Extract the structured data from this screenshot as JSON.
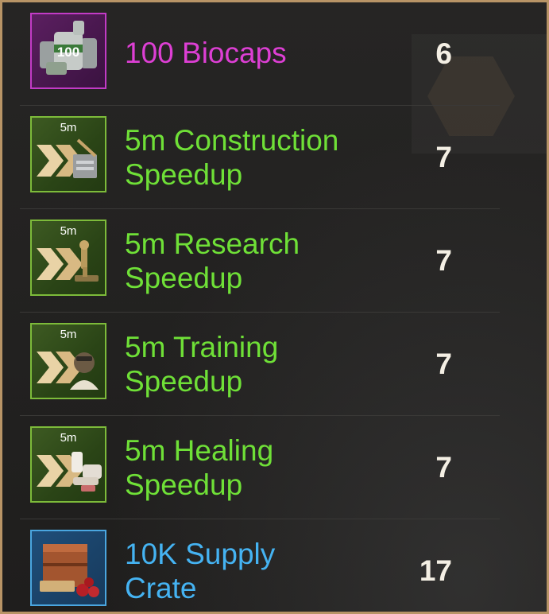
{
  "items": [
    {
      "name_line1": "100 Biocaps",
      "name_line2": "",
      "quantity": "6",
      "badge": "100",
      "rarity_color": "#dd3fd4",
      "icon": "biocaps-icon"
    },
    {
      "name_line1": "5m Construction",
      "name_line2": "Speedup",
      "quantity": "7",
      "badge": "5m",
      "rarity_color": "#6fe037",
      "icon": "construction-speedup-icon"
    },
    {
      "name_line1": "5m Research",
      "name_line2": "Speedup",
      "quantity": "7",
      "badge": "5m",
      "rarity_color": "#6fe037",
      "icon": "research-speedup-icon"
    },
    {
      "name_line1": "5m Training",
      "name_line2": "Speedup",
      "quantity": "7",
      "badge": "5m",
      "rarity_color": "#6fe037",
      "icon": "training-speedup-icon"
    },
    {
      "name_line1": "5m Healing",
      "name_line2": "Speedup",
      "quantity": "7",
      "badge": "5m",
      "rarity_color": "#6fe037",
      "icon": "healing-speedup-icon"
    },
    {
      "name_line1": "10K Supply",
      "name_line2": "Crate",
      "quantity": "17",
      "badge": "",
      "rarity_color": "#45b3f2",
      "icon": "supply-crate-icon"
    }
  ]
}
